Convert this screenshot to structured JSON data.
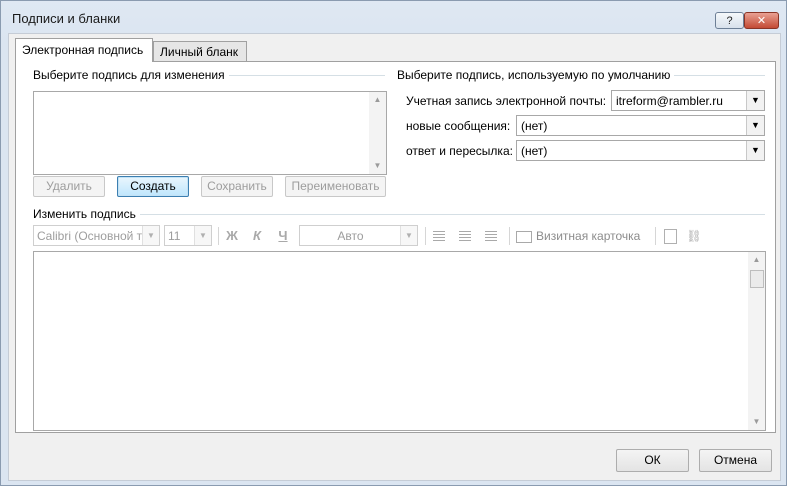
{
  "window": {
    "title": "Подписи и бланки",
    "help_label": "?",
    "close_label": "✕"
  },
  "tabs": [
    {
      "label": "Электронная подпись",
      "active": true
    },
    {
      "label": "Личный бланк",
      "active": false
    }
  ],
  "select_signature": {
    "label": "Выберите подпись для изменения",
    "items": []
  },
  "signature_buttons": {
    "delete": "Удалить",
    "create": "Создать",
    "save": "Сохранить",
    "rename": "Переименовать"
  },
  "defaults": {
    "label": "Выберите подпись, используемую по умолчанию",
    "account_label": "Учетная запись электронной почты:",
    "account_value": "itreform@rambler.ru",
    "new_messages_label": "новые сообщения:",
    "new_messages_value": "(нет)",
    "replies_label": "ответ и пересылка:",
    "replies_value": "(нет)"
  },
  "edit_signature": {
    "label": "Изменить подпись",
    "font": "Calibri (Основной текст)",
    "size": "11",
    "bold": "Ж",
    "italic": "К",
    "underline": "Ч",
    "color": "Авто",
    "business_card": "Визитная карточка",
    "content": ""
  },
  "dialog_buttons": {
    "ok": "ОК",
    "cancel": "Отмена"
  },
  "colors": {
    "focus_border": "#3c7fb1",
    "disabled_text": "#9d9d9d"
  }
}
